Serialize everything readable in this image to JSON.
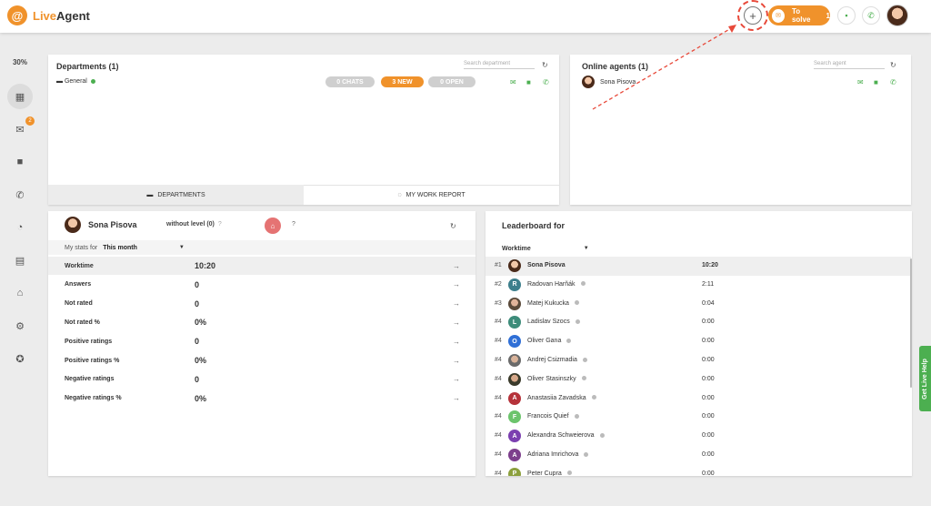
{
  "app": {
    "logo_letter": "@",
    "name_a": "Live",
    "name_b": "Agent"
  },
  "topbar": {
    "to_solve_label": "To solve",
    "to_solve_count": "1",
    "plus_glyph": "+"
  },
  "sidebar": {
    "percent": "30%",
    "badge": "2"
  },
  "departments": {
    "title": "Departments (1)",
    "search_placeholder": "Search department",
    "item": "General",
    "chats": "0 CHATS",
    "new": "3 NEW",
    "open": "0 OPEN",
    "tab_departments": "DEPARTMENTS",
    "tab_report": "MY WORK REPORT"
  },
  "online": {
    "title": "Online agents (1)",
    "search_placeholder": "Search agent",
    "agent": "Sona Pisova"
  },
  "stats": {
    "agent": "Sona Pisova",
    "level": "without level (0)",
    "level_q": "?",
    "level_q2": "?",
    "filter_label": "My stats for",
    "filter_value": "This month",
    "rows": [
      {
        "label": "Worktime",
        "value": "10:20"
      },
      {
        "label": "Answers",
        "value": "0"
      },
      {
        "label": "Not rated",
        "value": "0"
      },
      {
        "label": "Not rated %",
        "value": "0%"
      },
      {
        "label": "Positive ratings",
        "value": "0"
      },
      {
        "label": "Positive ratings %",
        "value": "0%"
      },
      {
        "label": "Negative ratings",
        "value": "0"
      },
      {
        "label": "Negative ratings %",
        "value": "0%"
      }
    ]
  },
  "leaderboard": {
    "title": "Leaderboard for",
    "filter": "Worktime",
    "rows": [
      {
        "rank": "#1",
        "initial": "",
        "name": "Sona Pisova",
        "time": "10:20",
        "color": "photo"
      },
      {
        "rank": "#2",
        "initial": "R",
        "name": "Radovan Harňák",
        "time": "2:11",
        "color": "#3d7f8c"
      },
      {
        "rank": "#3",
        "initial": "",
        "name": "Matej Kukucka",
        "time": "0:04",
        "color": "photo2"
      },
      {
        "rank": "#4",
        "initial": "L",
        "name": "Ladislav Szocs",
        "time": "0:00",
        "color": "#3d8c7a"
      },
      {
        "rank": "#4",
        "initial": "O",
        "name": "Oliver Gana",
        "time": "0:00",
        "color": "#2f6fd6"
      },
      {
        "rank": "#4",
        "initial": "",
        "name": "Andrej Csizmadia",
        "time": "0:00",
        "color": "photo3"
      },
      {
        "rank": "#4",
        "initial": "",
        "name": "Oliver Stasinszky",
        "time": "0:00",
        "color": "photo4"
      },
      {
        "rank": "#4",
        "initial": "A",
        "name": "Anastasiia Zavadska",
        "time": "0:00",
        "color": "#b5323a"
      },
      {
        "rank": "#4",
        "initial": "F",
        "name": "Francois Quief",
        "time": "0:00",
        "color": "#6cc46c"
      },
      {
        "rank": "#4",
        "initial": "A",
        "name": "Alexandra Schweierova",
        "time": "0:00",
        "color": "#7b3fb0"
      },
      {
        "rank": "#4",
        "initial": "A",
        "name": "Adriana Imrichova",
        "time": "0:00",
        "color": "#7d3f8c"
      },
      {
        "rank": "#4",
        "initial": "P",
        "name": "Peter Cupra",
        "time": "0:00",
        "color": "#8ca03d"
      }
    ]
  },
  "live_help": "Get Live Help",
  "colors": {
    "accent": "#f0922b",
    "green": "#4caf50",
    "annotation": "#e8493a"
  }
}
